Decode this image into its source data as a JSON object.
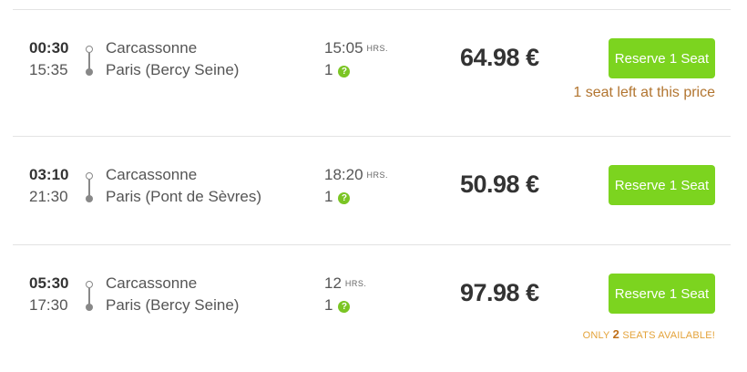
{
  "trips": [
    {
      "departure_time": "00:30",
      "arrival_time": "15:35",
      "origin": "Carcassonne",
      "destination": "Paris (Bercy Seine)",
      "duration": "15:05",
      "duration_unit": "HRS.",
      "transfers": "1",
      "price": "64.98 €",
      "button_label": "Reserve 1 Seat",
      "notice": "1 seat left at this price"
    },
    {
      "departure_time": "03:10",
      "arrival_time": "21:30",
      "origin": "Carcassonne",
      "destination": "Paris (Pont de Sèvres)",
      "duration": "18:20",
      "duration_unit": "HRS.",
      "transfers": "1",
      "price": "50.98 €",
      "button_label": "Reserve 1 Seat"
    },
    {
      "departure_time": "05:30",
      "arrival_time": "17:30",
      "origin": "Carcassonne",
      "destination": "Paris (Bercy Seine)",
      "duration": "12",
      "duration_unit": "HRS.",
      "transfers": "1",
      "price": "97.98 €",
      "button_label": "Reserve 1 Seat",
      "availability": {
        "prefix": "ONLY",
        "count": "2",
        "suffix": "SEATS AVAILABLE!"
      }
    }
  ],
  "help_icon_glyph": "?",
  "colors": {
    "accent_green": "#7cd41f",
    "help_green": "#7bc524",
    "notice_brown": "#b27530",
    "availability_orange": "#e4a33a"
  }
}
